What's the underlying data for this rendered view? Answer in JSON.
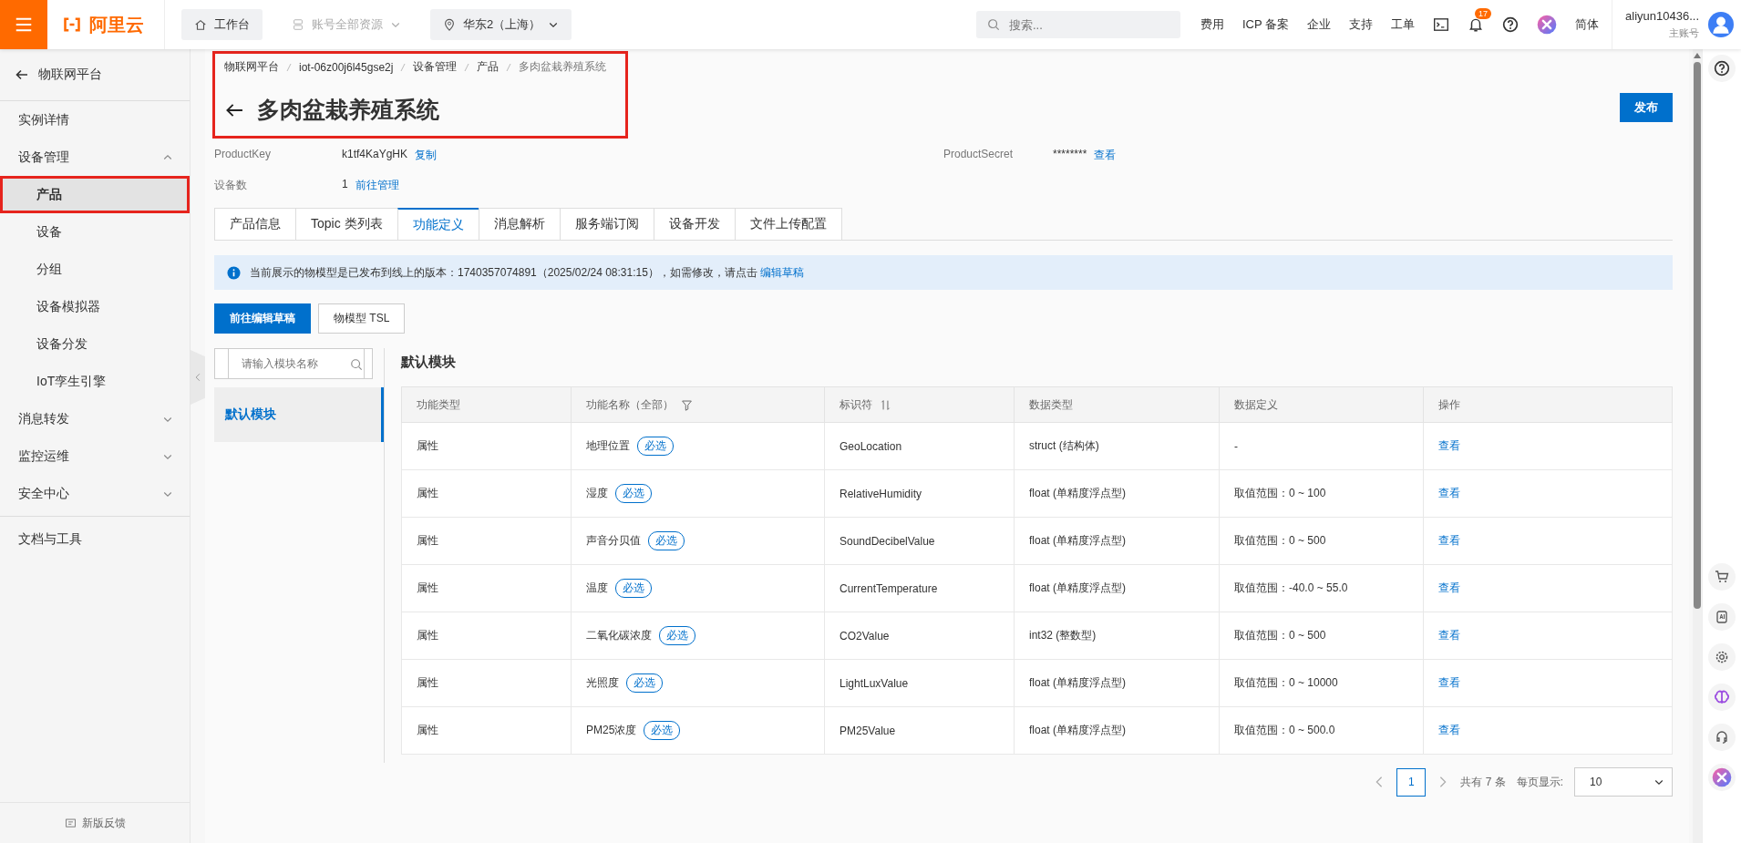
{
  "top_bar": {
    "logo": "阿里云",
    "workbench": "工作台",
    "resources": {
      "label": "账号全部资源",
      "disabled": true
    },
    "region": "华东2（上海）",
    "search": {
      "placeholder": "搜索..."
    },
    "links": [
      "费用",
      "ICP 备案",
      "企业",
      "支持",
      "工单"
    ],
    "notifications": "17",
    "language": "简体",
    "user": {
      "name": "aliyun10436...",
      "role": "主账号"
    }
  },
  "sidebar": {
    "back": "物联网平台",
    "items": [
      {
        "label": "实例详情",
        "kind": "link",
        "selected": false
      },
      {
        "label": "设备管理",
        "kind": "group",
        "expanded": true,
        "selected": false,
        "children": [
          {
            "label": "产品",
            "selected": true
          },
          {
            "label": "设备",
            "selected": false
          },
          {
            "label": "分组",
            "selected": false
          },
          {
            "label": "设备模拟器",
            "selected": false
          },
          {
            "label": "设备分发",
            "selected": false
          },
          {
            "label": "IoT孪生引擎",
            "selected": false
          }
        ]
      },
      {
        "label": "消息转发",
        "kind": "group",
        "expanded": false,
        "selected": false
      },
      {
        "label": "监控运维",
        "kind": "group",
        "expanded": false,
        "selected": false
      },
      {
        "label": "安全中心",
        "kind": "group",
        "expanded": false,
        "selected": false
      },
      {
        "label": "文档与工具",
        "kind": "link",
        "selected": false
      }
    ],
    "feedback": "新版反馈"
  },
  "breadcrumb": [
    "物联网平台",
    "iot-06z00j6l45gse2j",
    "设备管理",
    "产品",
    "多肉盆栽养殖系统"
  ],
  "title": "多肉盆栽养殖系统",
  "publish_button": "发布",
  "fields": [
    {
      "label": "ProductKey",
      "value": "k1tf4KaYgHK",
      "link": "复制"
    },
    {
      "label": "ProductSecret",
      "value": "********",
      "link": "查看"
    },
    {
      "label": "设备数",
      "value": "1",
      "link": "前往管理"
    }
  ],
  "tabs": [
    {
      "label": "产品信息",
      "selected": false
    },
    {
      "label": "Topic 类列表",
      "selected": false
    },
    {
      "label": "功能定义",
      "selected": true
    },
    {
      "label": "消息解析",
      "selected": false
    },
    {
      "label": "服务端订阅",
      "selected": false
    },
    {
      "label": "设备开发",
      "selected": false
    },
    {
      "label": "文件上传配置",
      "selected": false
    }
  ],
  "notice": {
    "text": "当前展示的物模型是已发布到线上的版本：1740357074891（2025/02/24 08:31:15），如需修改，请点击 ",
    "link": "编辑草稿"
  },
  "buttons": [
    {
      "label": "前往编辑草稿",
      "kind": "primary"
    },
    {
      "label": "物模型 TSL",
      "kind": "default"
    }
  ],
  "module_search": {
    "placeholder": "请输入模块名称"
  },
  "modules": [
    {
      "label": "默认模块",
      "selected": true
    }
  ],
  "section_title": "默认模块",
  "table": {
    "columns": [
      "功能类型",
      "功能名称（全部）",
      "标识符",
      "数据类型",
      "数据定义",
      "操作"
    ],
    "rows": [
      {
        "type": "属性",
        "name": "地理位置",
        "tag": "必选",
        "identifier": "GeoLocation",
        "data_type": "struct (结构体)",
        "definition": "-",
        "action": "查看"
      },
      {
        "type": "属性",
        "name": "湿度",
        "tag": "必选",
        "identifier": "RelativeHumidity",
        "data_type": "float (单精度浮点型)",
        "definition": "取值范围：0 ~ 100",
        "action": "查看"
      },
      {
        "type": "属性",
        "name": "声音分贝值",
        "tag": "必选",
        "identifier": "SoundDecibelValue",
        "data_type": "float (单精度浮点型)",
        "definition": "取值范围：0 ~ 500",
        "action": "查看"
      },
      {
        "type": "属性",
        "name": "温度",
        "tag": "必选",
        "identifier": "CurrentTemperature",
        "data_type": "float (单精度浮点型)",
        "definition": "取值范围：-40.0 ~ 55.0",
        "action": "查看"
      },
      {
        "type": "属性",
        "name": "二氧化碳浓度",
        "tag": "必选",
        "identifier": "CO2Value",
        "data_type": "int32 (整数型)",
        "definition": "取值范围：0 ~ 500",
        "action": "查看"
      },
      {
        "type": "属性",
        "name": "光照度",
        "tag": "必选",
        "identifier": "LightLuxValue",
        "data_type": "float (单精度浮点型)",
        "definition": "取值范围：0 ~ 10000",
        "action": "查看"
      },
      {
        "type": "属性",
        "name": "PM25浓度",
        "tag": "必选",
        "identifier": "PM25Value",
        "data_type": "float (单精度浮点型)",
        "definition": "取值范围：0 ~ 500.0",
        "action": "查看"
      }
    ]
  },
  "pagination": {
    "pages": [
      {
        "label": "1",
        "selected": true
      }
    ],
    "total": "共有 7 条",
    "page_size_label": "每页显示:",
    "page_size": "10"
  }
}
